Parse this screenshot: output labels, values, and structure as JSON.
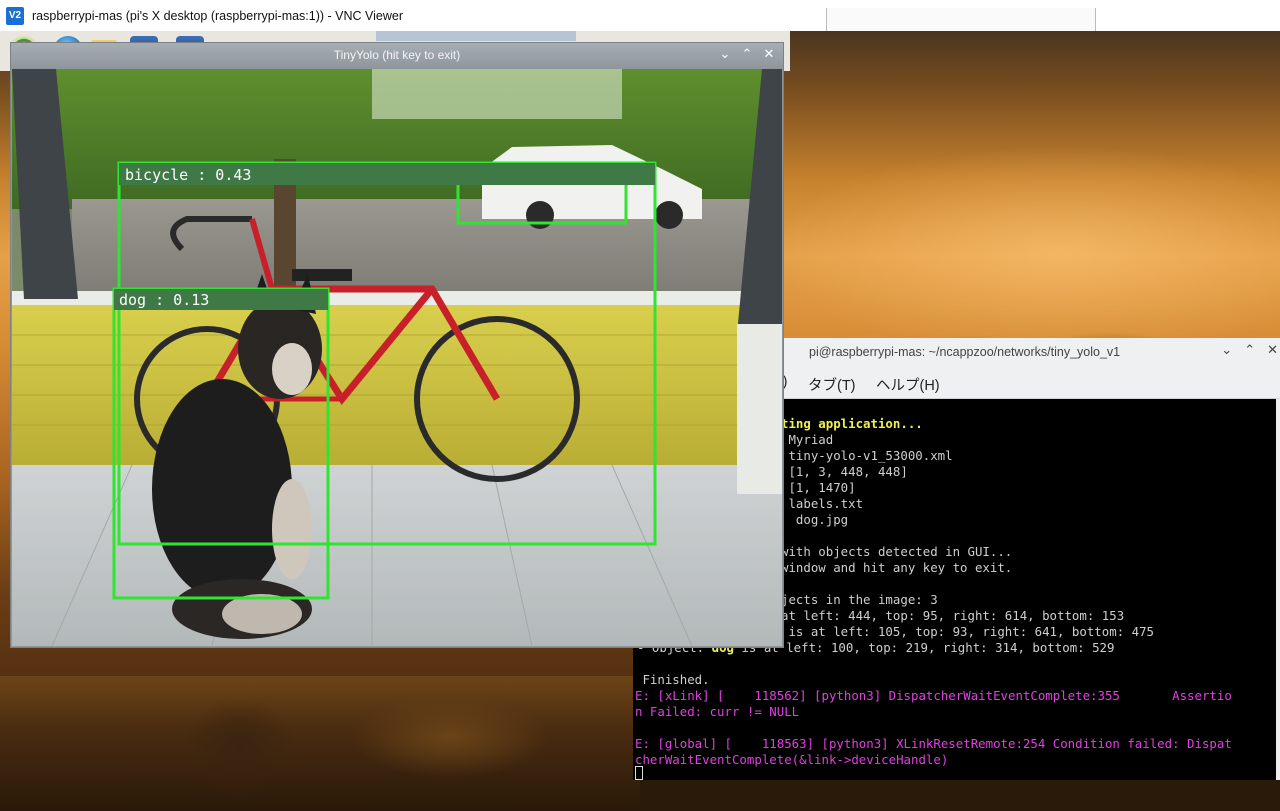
{
  "vnc": {
    "logo_text": "V2",
    "title": "raspberrypi-mas (pi's X desktop (raspberrypi-mas:1)) - VNC Viewer"
  },
  "yolo_window": {
    "title": "TinyYolo (hit key to exit)",
    "controls": {
      "minimize": "⌄",
      "maximize": "⌃",
      "close": "✕"
    },
    "detections": [
      {
        "label": "bicycle : 0.43"
      },
      {
        "label": "dog : 0.13"
      }
    ]
  },
  "terminal": {
    "title": "pi@raspberrypi-mas: ~/ncappzoo/networks/tiny_yolo_v1",
    "controls": {
      "minimize": "⌄",
      "maximize": "⌃",
      "close": "✕"
    },
    "menu": {
      "edit_partial": "E)",
      "tabs": "タブ(T)",
      "help": "ヘルプ(H)"
    },
    "lines": [
      "ting application...",
      " Myriad",
      " tiny-yolo-v1_53000.xml",
      " [1, 3, 448, 448]",
      " [1, 1470]",
      " labels.txt",
      "  dog.jpg",
      "",
      "with objects detected in GUI...",
      "window and hit any key to exit.",
      "",
      "jects in the image: 3",
      "at left: 444, top: 95, right: 614, bottom: 153",
      " is at left: 105, top: 93, right: 641, bottom: 475",
      "- Object: ",
      "dog",
      " is at left: 100, top: 219, right: 314, bottom: 529",
      "",
      " Finished.",
      "E: [xLink] [    118562] [python3] DispatcherWaitEventComplete:355       Assertio",
      "n Failed: curr != NULL",
      "",
      "E: [global] [    118563] [python3] XLinkResetRemote:254 Condition failed: Dispat",
      "cherWaitEventComplete(&link->deviceHandle)"
    ]
  },
  "colors": {
    "detection_box": "#2fe52f",
    "label_bg": "#3f7a46",
    "terminal_yellow": "#f0f050",
    "terminal_magenta": "#e040e0"
  }
}
